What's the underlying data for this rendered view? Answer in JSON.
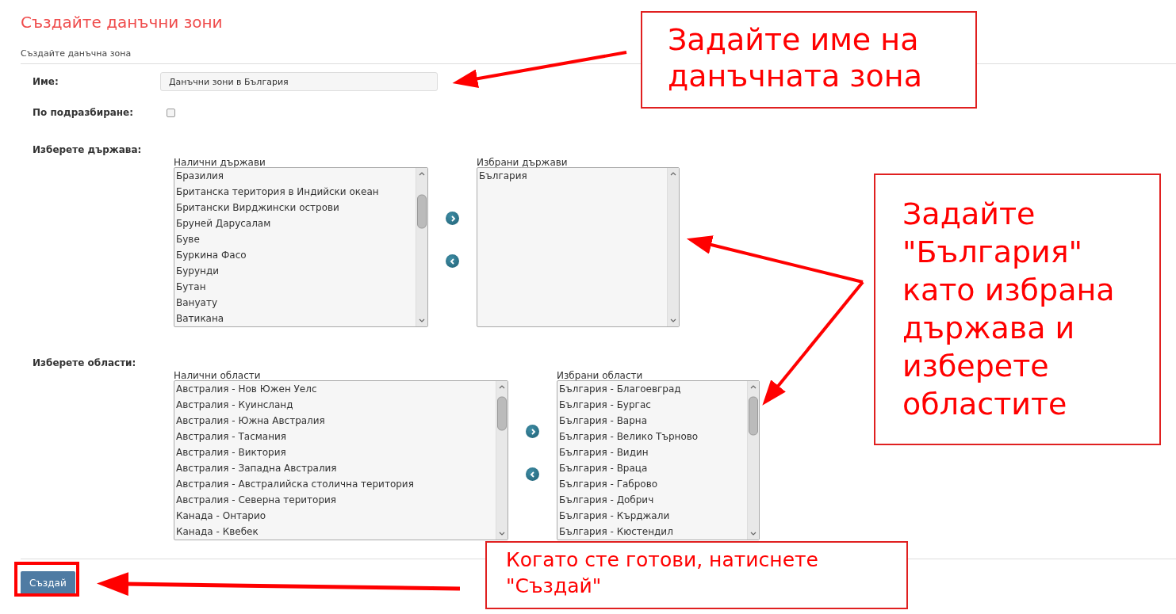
{
  "page_title": "Създайте данъчни зони",
  "section_title": "Създайте данъчна зона",
  "name_field": {
    "label": "Име:",
    "value": "Данъчни зони в България"
  },
  "default_field": {
    "label": "По подразбиране:",
    "checked": false
  },
  "country_picker": {
    "label": "Изберете държава:",
    "available": {
      "caption": "Налични държави",
      "items": [
        "Бразилия",
        "Британска територия в Индийски океан",
        "Британски Вирджински острови",
        "Бруней Дарусалам",
        "Буве",
        "Буркина Фасо",
        "Бурунди",
        "Бутан",
        "Вануату",
        "Ватикана"
      ]
    },
    "selected": {
      "caption": "Избрани държави",
      "items": [
        "България"
      ]
    }
  },
  "region_picker": {
    "label": "Изберете области:",
    "available": {
      "caption": "Налични области",
      "items": [
        "Австралия - Нов Южен Уелс",
        "Австралия - Куинсланд",
        "Австралия - Южна Австралия",
        "Австралия - Тасмания",
        "Австралия - Виктория",
        "Австралия - Западна Австралия",
        "Австралия - Австралийска столична територия",
        "Австралия - Северна територия",
        "Канада - Онтарио",
        "Канада - Квебек"
      ]
    },
    "selected": {
      "caption": "Избрани области",
      "items": [
        "България - Благоевград",
        "България - Бургас",
        "България - Варна",
        "България - Велико Търново",
        "България - Видин",
        "България - Враца",
        "България - Габрово",
        "България - Добрич",
        "България - Кърджали",
        "България - Кюстендил"
      ]
    }
  },
  "create_button": "Създай",
  "annotations": [
    {
      "kind": "name",
      "text": "Задайте име на\nданъчната зона"
    },
    {
      "kind": "country",
      "text": "Задайте\n\"България\"\nкато избрана\nдържава и\nизберете\nобластите"
    },
    {
      "kind": "button",
      "text": "Когато сте готови, натиснете\n\"Създай\""
    }
  ]
}
